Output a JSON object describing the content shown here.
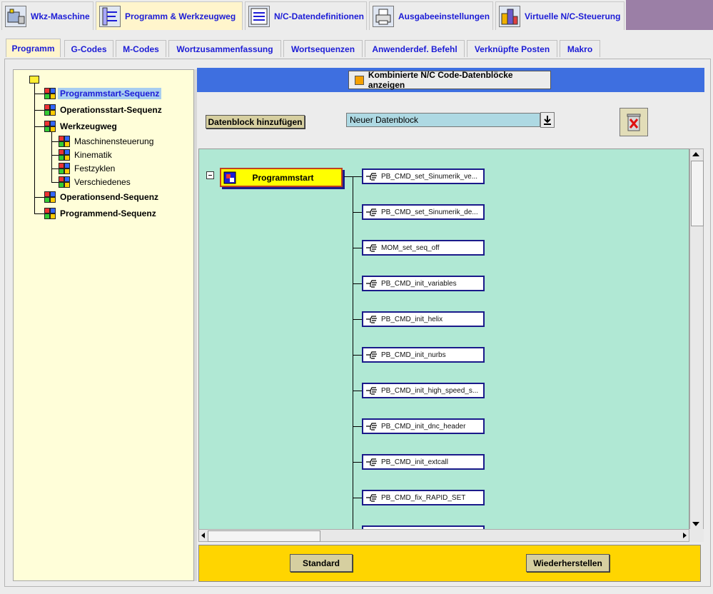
{
  "top_tabs": [
    {
      "label": "Wkz-Maschine",
      "icon": "machine-icon"
    },
    {
      "label": "Programm & Werkzeugweg",
      "icon": "program-toolpath-icon"
    },
    {
      "label": "N/C-Datendefinitionen",
      "icon": "nc-data-definitions-icon"
    },
    {
      "label": "Ausgabeeinstellungen",
      "icon": "printer-icon"
    },
    {
      "label": "Virtuelle N/C-Steuerung",
      "icon": "virtual-nc-controller-icon"
    }
  ],
  "sub_tabs": [
    "Programm",
    "G-Codes",
    "M-Codes",
    "Wortzusammenfassung",
    "Wortsequenzen",
    "Anwenderdef. Befehl",
    "Verknüpfte Posten",
    "Makro"
  ],
  "tree": {
    "items": [
      {
        "label": "Programmstart-Sequenz"
      },
      {
        "label": "Operationsstart-Sequenz"
      },
      {
        "label": "Werkzeugweg"
      },
      {
        "label": "Maschinensteuerung"
      },
      {
        "label": "Kinematik"
      },
      {
        "label": "Festzyklen"
      },
      {
        "label": "Verschiedenes"
      },
      {
        "label": "Operationsend-Sequenz"
      },
      {
        "label": "Programmend-Sequenz"
      }
    ]
  },
  "toolbar": {
    "combined_label": "Kombinierte N/C Code-Datenblöcke anzeigen",
    "add_block_label": "Datenblock hinzufügen",
    "new_block_value": "Neuer Datenblock"
  },
  "sequence": {
    "root_label": "Programmstart",
    "blocks": [
      "PB_CMD_set_Sinumerik_ve...",
      "PB_CMD_set_Sinumerik_de...",
      "MOM_set_seq_off",
      "PB_CMD_init_variables",
      "PB_CMD_init_helix",
      "PB_CMD_init_nurbs",
      "PB_CMD_init_high_speed_s...",
      "PB_CMD_init_dnc_header",
      "PB_CMD_init_extcall",
      "PB_CMD_fix_RAPID_SET"
    ]
  },
  "footer": {
    "standard_label": "Standard",
    "restore_label": "Wiederherstellen"
  },
  "colors": {
    "tab_text": "#1c1cd6",
    "canvas_bg": "#b0e8d4",
    "blue_bar": "#3e6fe0",
    "footer_bg": "#ffd500",
    "tree_bg": "#fffed9",
    "active_tab_bg": "#fff5cc",
    "tab_fill": "#9b7fa6"
  }
}
